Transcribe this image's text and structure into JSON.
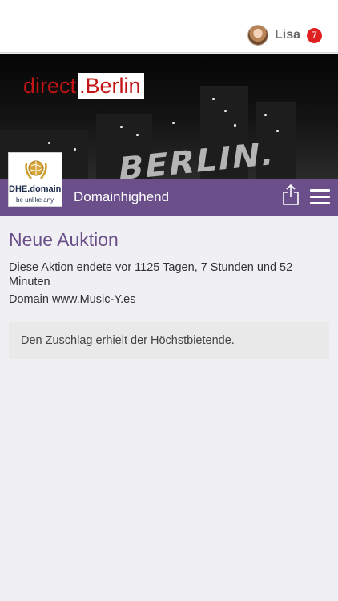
{
  "header": {
    "user_name": "Lisa",
    "notification_count": "7"
  },
  "banner": {
    "brand_part1": "direct",
    "brand_part2": ".Berlin",
    "skyline_sign": "BERLIN."
  },
  "logo": {
    "line1": "DHE.domain",
    "line2": "be unlike any"
  },
  "navbar": {
    "title": "Domainhighend"
  },
  "main": {
    "heading": "Neue Auktion",
    "ended_text": "Diese Aktion endete vor 1125 Tagen, 7 Stunden und 52 Minuten",
    "domain_text": "Domain www.Music-Y.es",
    "notice_text": "Den Zuschlag erhielt der Höchstbietende."
  },
  "colors": {
    "accent_purple": "#6b4f8a",
    "brand_red": "#c41414",
    "badge_red": "#e02020",
    "background": "#efeff4"
  },
  "icons": {
    "share": "share-icon",
    "menu": "hamburger-menu-icon",
    "avatar": "user-avatar"
  }
}
